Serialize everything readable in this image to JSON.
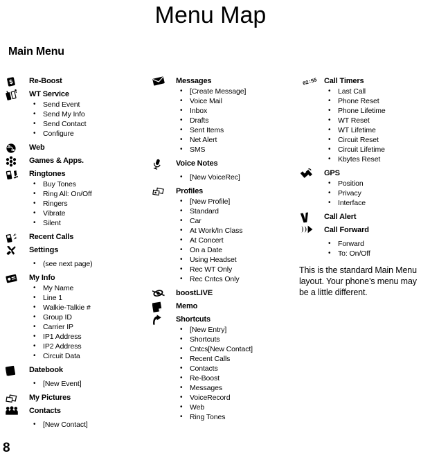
{
  "page": {
    "title": "Menu Map",
    "section_heading": "Main Menu",
    "page_number": "8",
    "note": "This is the standard Main Menu layout. Your phone’s menu may be a little different.",
    "bullet_glyph": "•"
  },
  "columns": [
    {
      "groups": [
        {
          "icon": "dollar-badge-icon",
          "label": "Re-Boost",
          "items": []
        },
        {
          "icon": "walkie-talkie-icon",
          "label": "WT Service",
          "items": [
            "Send Event",
            "Send My Info",
            "Send Contact",
            "Configure"
          ]
        },
        {
          "icon": "globe-icon",
          "label": "Web",
          "items": []
        },
        {
          "icon": "games-icon",
          "label": "Games & Apps.",
          "items": []
        },
        {
          "icon": "ringtones-icon",
          "label": "Ringtones",
          "items": [
            "Buy Tones",
            "Ring All: On/Off",
            "Ringers",
            "Vibrate",
            "Silent"
          ]
        },
        {
          "icon": "recent-calls-icon",
          "label": "Recent Calls",
          "items": []
        },
        {
          "icon": "settings-tools-icon",
          "label": "Settings",
          "items": [
            "(see next page)"
          ]
        },
        {
          "icon": "my-info-card-icon",
          "label": "My Info",
          "items": [
            "My Name",
            "Line 1",
            "Walkie-Talkie #",
            "Group ID",
            "Carrier IP",
            "IP1 Address",
            "IP2 Address",
            "Circuit Data"
          ]
        },
        {
          "icon": "datebook-icon",
          "label": "Datebook",
          "items": [
            "[New Event]"
          ]
        },
        {
          "icon": "my-pictures-icon",
          "label": "My Pictures",
          "items": []
        },
        {
          "icon": "contacts-people-icon",
          "label": "Contacts",
          "items": [
            "[New Contact]"
          ]
        }
      ]
    },
    {
      "groups": [
        {
          "icon": "envelope-icon",
          "label": "Messages",
          "items": [
            "[Create Message]",
            "Voice Mail",
            "Inbox",
            "Drafts",
            "Sent Items",
            "Net Alert",
            "SMS"
          ]
        },
        {
          "icon": "microphone-icon",
          "label": "Voice Notes",
          "items": [
            "[New VoiceRec]"
          ]
        },
        {
          "icon": "profiles-cards-icon",
          "label": "Profiles",
          "items": [
            "[New Profile]",
            "Standard",
            "Car",
            "At Work/In Class",
            "At Concert",
            "On a Date",
            "Using Headset",
            "Rec WT Only",
            "Rec Cntcs Only"
          ]
        },
        {
          "icon": "boostlive-icon",
          "label": "boostLIVE",
          "items": []
        },
        {
          "icon": "memo-icon",
          "label": "Memo",
          "items": []
        },
        {
          "icon": "shortcuts-arrow-icon",
          "label": "Shortcuts",
          "items": [
            "[New Entry]",
            "Shortcuts",
            "Cntcs[New Contact]",
            "Recent Calls",
            "Contacts",
            "Re-Boost",
            "Messages",
            "VoiceRecord",
            "Web",
            "Ring Tones"
          ]
        }
      ]
    },
    {
      "groups": [
        {
          "icon": "call-timer-clock-icon",
          "icon_text": "02:55",
          "label": "Call Timers",
          "items": [
            "Last Call",
            "Phone Reset",
            "Phone Lifetime",
            "WT Reset",
            "WT Lifetime",
            "Circuit Reset",
            "Circuit Lifetime",
            "Kbytes Reset"
          ]
        },
        {
          "icon": "gps-satellite-icon",
          "label": "GPS",
          "items": [
            "Position",
            "Privacy",
            "Interface"
          ]
        },
        {
          "icon": "call-alert-icon",
          "label": "Call Alert",
          "items": []
        },
        {
          "icon": "call-forward-icon",
          "label": "Call Forward",
          "items": [
            "Forward",
            "To: On/Off"
          ]
        }
      ]
    }
  ]
}
